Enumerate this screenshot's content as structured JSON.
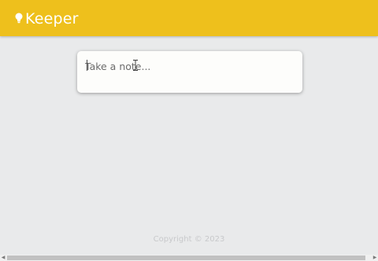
{
  "header": {
    "title": "Keeper",
    "logo_icon": "lightbulb-icon",
    "background": "#eec01c"
  },
  "note_form": {
    "placeholder": "Take a note...",
    "value": ""
  },
  "footer": {
    "copyright": "Copyright © 2023"
  },
  "scrollbar": {
    "left_arrow": "◀",
    "right_arrow": "▶"
  },
  "colors": {
    "accent": "#eec01c",
    "page_background": "#e9eaeb",
    "card_background": "#fdfdfb"
  }
}
